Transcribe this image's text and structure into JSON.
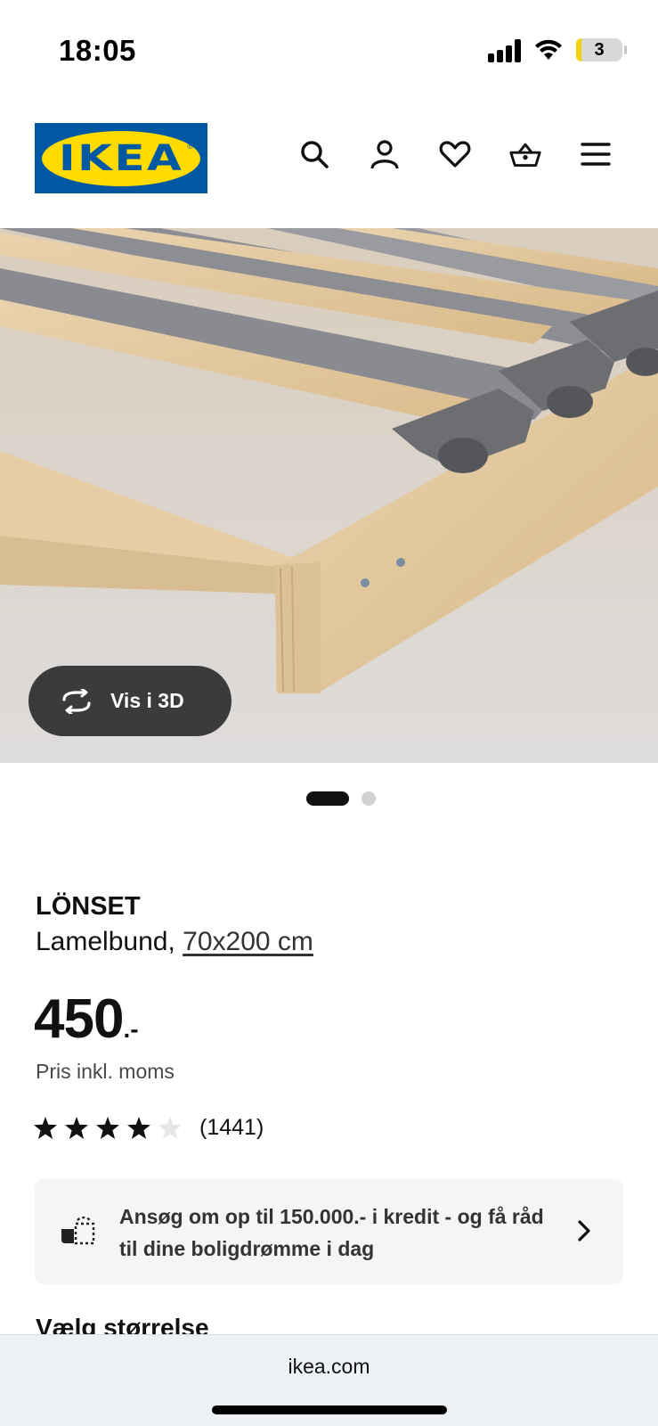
{
  "status_bar": {
    "time": "18:05",
    "battery": "3"
  },
  "header": {
    "logo_text": "IKEA",
    "nav": [
      {
        "name": "search-icon"
      },
      {
        "name": "profile-icon"
      },
      {
        "name": "heart-icon"
      },
      {
        "name": "basket-icon"
      },
      {
        "name": "menu-icon"
      }
    ]
  },
  "gallery": {
    "view_3d_label": "Vis i 3D",
    "current_index": 1,
    "total": 2
  },
  "product": {
    "name": "LÖNSET",
    "type": "Lamelbund,",
    "size": "70x200 cm",
    "price": "450",
    "price_suffix": ".-",
    "vat_note": "Pris inkl. moms",
    "rating": 4,
    "rating_max": 5,
    "review_count": "(1441)"
  },
  "credit_banner": {
    "text": "Ansøg om op til 150.000.- i kredit - og få råd til dine boligdrømme i dag"
  },
  "section_heading": "Vælg størrelse",
  "browser": {
    "url": "ikea.com"
  },
  "colors": {
    "ikea_blue": "#0058a3",
    "ikea_yellow": "#ffdb00",
    "button_dark": "#3b3b3b",
    "banner_bg": "#f5f5f5"
  }
}
